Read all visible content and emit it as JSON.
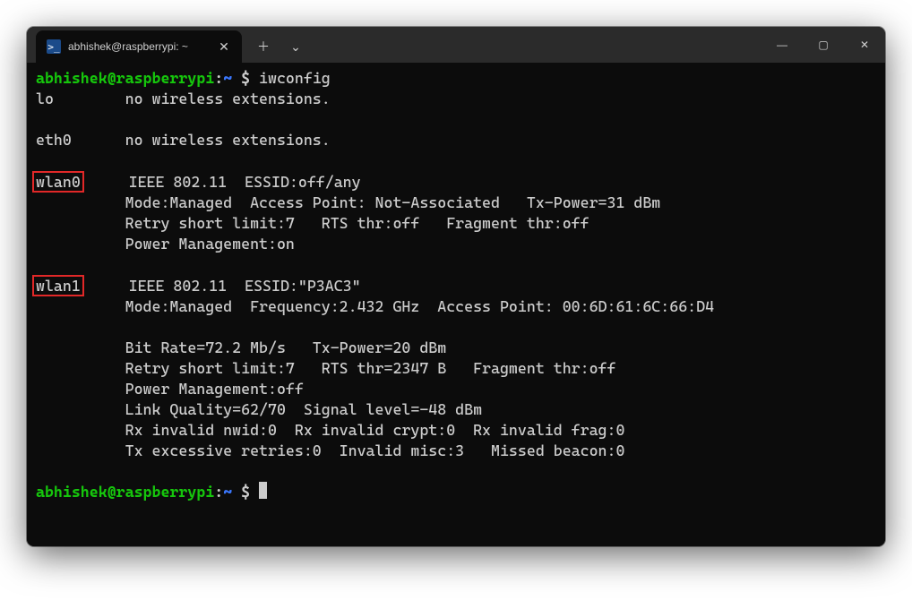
{
  "window": {
    "tab_title": "abhishek@raspberrypi: ~",
    "controls": {
      "min": "—",
      "max": "▢",
      "close": "✕"
    },
    "new_tab": "＋",
    "dropdown": "⌄",
    "tab_close": "✕"
  },
  "prompt": {
    "user_host": "abhishek@raspberrypi",
    "colon": ":",
    "path": "~",
    "symbol": " $ "
  },
  "cmd1": "iwconfig",
  "out": {
    "lo": "lo        no wireless extensions.",
    "blank1": "",
    "eth0": "eth0      no wireless extensions.",
    "blank2": "",
    "wlan0_name": "wlan0",
    "wlan0_l1": "     IEEE 802.11  ESSID:off/any",
    "wlan0_l2": "          Mode:Managed  Access Point: Not-Associated   Tx-Power=31 dBm",
    "wlan0_l3": "          Retry short limit:7   RTS thr:off   Fragment thr:off",
    "wlan0_l4": "          Power Management:on",
    "blank3": "",
    "wlan1_name": "wlan1",
    "wlan1_l1": "     IEEE 802.11  ESSID:\"P3AC3\"",
    "wlan1_l2": "          Mode:Managed  Frequency:2.432 GHz  Access Point: 00:6D:61:6C:66:D4",
    "blank4": "",
    "wlan1_l3": "          Bit Rate=72.2 Mb/s   Tx-Power=20 dBm",
    "wlan1_l4": "          Retry short limit:7   RTS thr=2347 B   Fragment thr:off",
    "wlan1_l5": "          Power Management:off",
    "wlan1_l6": "          Link Quality=62/70  Signal level=-48 dBm",
    "wlan1_l7": "          Rx invalid nwid:0  Rx invalid crypt:0  Rx invalid frag:0",
    "wlan1_l8": "          Tx excessive retries:0  Invalid misc:3   Missed beacon:0",
    "blank5": ""
  }
}
